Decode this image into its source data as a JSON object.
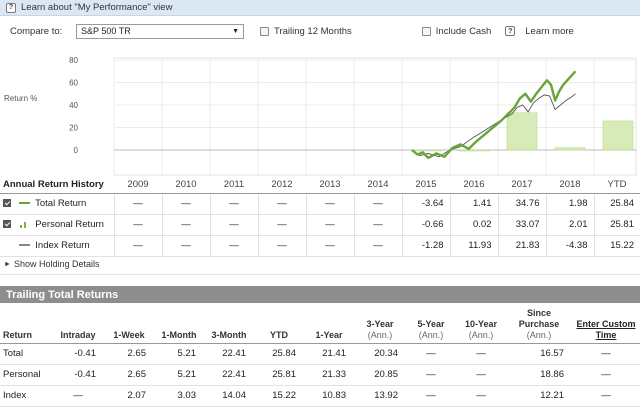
{
  "info_bar": {
    "icon": "help-icon",
    "text": "Learn about \"My Performance\" view"
  },
  "controls": {
    "compare_label": "Compare to:",
    "compare_value": "S&P 500 TR",
    "trailing_label": "Trailing 12 Months",
    "include_cash_label": "Include Cash",
    "learn_more_label": "Learn more"
  },
  "chart": {
    "y_label": "Return %",
    "y_ticks": [
      "80",
      "60",
      "40",
      "20",
      "0"
    ],
    "colors": {
      "total": "#6aa336",
      "index": "#555555",
      "bars": "#d6ebb8",
      "bars_border": "#b9d992"
    }
  },
  "annual": {
    "title": "Annual Return History",
    "years": [
      "2009",
      "2010",
      "2011",
      "2012",
      "2013",
      "2014",
      "2015",
      "2016",
      "2017",
      "2018",
      "YTD"
    ],
    "rows": [
      {
        "label": "Total Return",
        "values": [
          "—",
          "—",
          "—",
          "—",
          "—",
          "—",
          "-3.64",
          "1.41",
          "34.76",
          "1.98",
          "25.84"
        ]
      },
      {
        "label": "Personal Return",
        "values": [
          "—",
          "—",
          "—",
          "—",
          "—",
          "—",
          "-0.66",
          "0.02",
          "33.07",
          "2.01",
          "25.81"
        ]
      },
      {
        "label": "Index Return",
        "values": [
          "—",
          "—",
          "—",
          "—",
          "—",
          "—",
          "-1.28",
          "11.93",
          "21.83",
          "-4.38",
          "15.22"
        ]
      }
    ]
  },
  "show_details": "Show Holding Details",
  "trailing": {
    "title": "Trailing Total Returns",
    "headers": [
      {
        "label": "Return",
        "sub": ""
      },
      {
        "label": "Intraday",
        "sub": ""
      },
      {
        "label": "1-Week",
        "sub": ""
      },
      {
        "label": "1-Month",
        "sub": ""
      },
      {
        "label": "3-Month",
        "sub": ""
      },
      {
        "label": "YTD",
        "sub": ""
      },
      {
        "label": "1-Year",
        "sub": ""
      },
      {
        "label": "3-Year",
        "sub": "(Ann.)"
      },
      {
        "label": "5-Year",
        "sub": "(Ann.)"
      },
      {
        "label": "10-Year",
        "sub": "(Ann.)"
      },
      {
        "label": "Since Purchase",
        "sub": "(Ann.)"
      },
      {
        "label": "Enter Custom Time",
        "sub": ""
      }
    ],
    "rows": [
      {
        "label": "Total",
        "values": [
          "-0.41",
          "2.65",
          "5.21",
          "22.41",
          "25.84",
          "21.41",
          "20.34",
          "—",
          "—",
          "16.57",
          "—"
        ]
      },
      {
        "label": "Personal",
        "values": [
          "-0.41",
          "2.65",
          "5.21",
          "22.41",
          "25.81",
          "21.33",
          "20.85",
          "—",
          "—",
          "18.86",
          "—"
        ]
      },
      {
        "label": "Index",
        "values": [
          "—",
          "2.07",
          "3.03",
          "14.04",
          "15.22",
          "10.83",
          "13.92",
          "—",
          "—",
          "12.21",
          "—"
        ]
      }
    ]
  }
}
